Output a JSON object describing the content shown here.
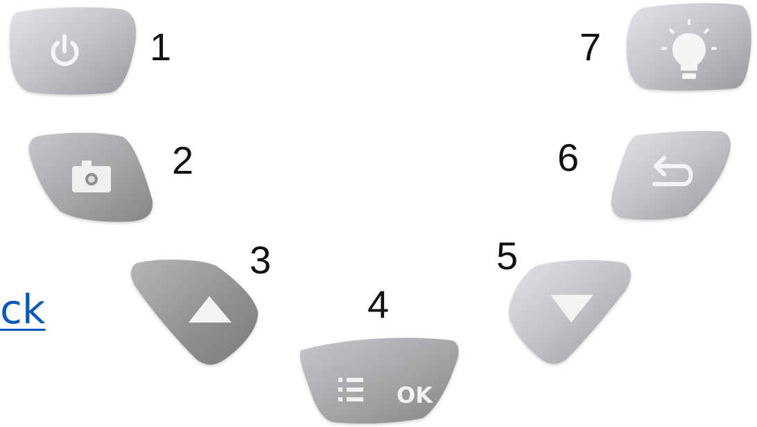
{
  "labels": {
    "n1": "1",
    "n2": "2",
    "n3": "3",
    "n4": "4",
    "n5": "5",
    "n6": "6",
    "n7": "7"
  },
  "link_text": "ck",
  "ok_button": {
    "text": "OK"
  },
  "colors": {
    "button_light": "#d9d7df",
    "button_dark": "#8c8c90",
    "icon": "#f2f2f2",
    "link": "#0a58b8",
    "label": "#111111"
  },
  "icons": {
    "button_1": "power-icon",
    "button_2": "camera-icon",
    "button_3": "up-triangle-icon",
    "button_4": "menu-list-icon",
    "button_5": "down-triangle-icon",
    "button_6": "back-arrow-icon",
    "button_7": "light-bulb-icon"
  }
}
